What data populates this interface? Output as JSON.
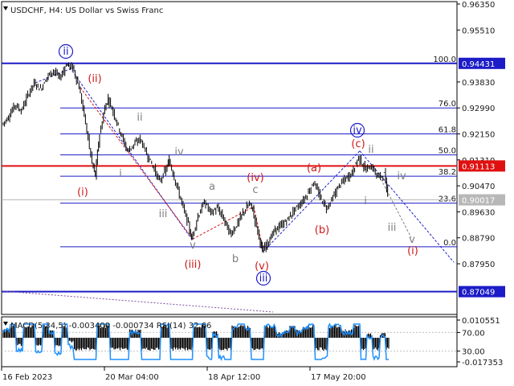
{
  "title": "USDCHF, H4:  US Dollar vs Swiss Franc",
  "colors": {
    "candle": "#000000",
    "fib_line": "#1c1cc8",
    "red_line": "#e01010",
    "grey_line": "#b8b8b8",
    "wave_red": "#d01818",
    "wave_grey": "#808080",
    "circle": "#1c1cc8",
    "macd_hist": "#000000",
    "rsi": "#1e90ff"
  },
  "price_axis": {
    "labels": [
      "0.96350",
      "0.95510",
      "0.93830",
      "0.92990",
      "0.92150",
      "0.91310",
      "0.90470",
      "0.89630",
      "0.88790",
      "0.87950"
    ],
    "values": [
      0.9635,
      0.9551,
      0.9383,
      0.9299,
      0.9215,
      0.9131,
      0.9047,
      0.8963,
      0.8879,
      0.8795
    ],
    "highlighted": [
      {
        "label": "0.94431",
        "value": 0.94431,
        "style": "blue"
      },
      {
        "label": "0.91113",
        "value": 0.91113,
        "style": "red"
      },
      {
        "label": "0.90017",
        "value": 0.90017,
        "style": "grey"
      },
      {
        "label": "0.87049",
        "value": 0.87049,
        "style": "blue"
      }
    ]
  },
  "fib_levels": [
    {
      "label": "100.0",
      "value": 0.9443
    },
    {
      "label": "76.0",
      "value": 0.9299
    },
    {
      "label": "61.8",
      "value": 0.9215
    },
    {
      "label": "50.0",
      "value": 0.9147
    },
    {
      "label": "38.2",
      "value": 0.9078
    },
    {
      "label": "23.6",
      "value": 0.8991
    },
    {
      "label": "0.0",
      "value": 0.885
    }
  ],
  "time_axis": [
    "16 Feb 2023",
    "20 Mar 04:00",
    "18 Apr 12:00",
    "17 May 20:00"
  ],
  "wave_labels": [
    {
      "text": "ii",
      "style": "circle"
    },
    {
      "text": "(ii)",
      "style": "red"
    },
    {
      "text": "ii",
      "style": "grey"
    },
    {
      "text": "i",
      "style": "grey"
    },
    {
      "text": "(i)",
      "style": "red"
    },
    {
      "text": "iv",
      "style": "grey"
    },
    {
      "text": "iii",
      "style": "grey"
    },
    {
      "text": "a",
      "style": "grey"
    },
    {
      "text": "(iv)",
      "style": "red"
    },
    {
      "text": "c",
      "style": "grey"
    },
    {
      "text": "v",
      "style": "grey"
    },
    {
      "text": "(iii)",
      "style": "red"
    },
    {
      "text": "b",
      "style": "grey"
    },
    {
      "text": "(v)",
      "style": "red"
    },
    {
      "text": "iii",
      "style": "circle"
    },
    {
      "text": "iv",
      "style": "circle"
    },
    {
      "text": "(c)",
      "style": "red"
    },
    {
      "text": "(a)",
      "style": "red"
    },
    {
      "text": "ii",
      "style": "grey"
    },
    {
      "text": "i",
      "style": "grey"
    },
    {
      "text": "(b)",
      "style": "red"
    },
    {
      "text": "iv",
      "style": "grey"
    },
    {
      "text": "iii",
      "style": "grey"
    },
    {
      "text": "v",
      "style": "grey"
    },
    {
      "text": "(i)",
      "style": "red"
    }
  ],
  "indicator": {
    "title": "MACD(5,34,5) -0.003400 -0.000734 RSI(14) 32.66",
    "axis_labels": [
      "0.010551",
      "70.00",
      "30.00",
      "-0.017353"
    ]
  },
  "chart_data": {
    "type": "candlestick",
    "symbol": "USDCHF",
    "timeframe": "H4",
    "title": "USDCHF, H4:  US Dollar vs Swiss Franc",
    "ylim": [
      0.8795,
      0.9635
    ],
    "close_path": [
      [
        0,
        0.9245
      ],
      [
        2,
        0.927
      ],
      [
        4,
        0.931
      ],
      [
        6,
        0.929
      ],
      [
        8,
        0.934
      ],
      [
        10,
        0.938
      ],
      [
        12,
        0.936
      ],
      [
        14,
        0.94
      ],
      [
        16,
        0.942
      ],
      [
        18,
        0.9395
      ],
      [
        20,
        0.944
      ],
      [
        22,
        0.943
      ],
      [
        24,
        0.9365
      ],
      [
        26,
        0.925
      ],
      [
        28,
        0.912
      ],
      [
        29,
        0.908
      ],
      [
        30,
        0.919
      ],
      [
        32,
        0.93
      ],
      [
        33,
        0.933
      ],
      [
        35,
        0.9275
      ],
      [
        37,
        0.9215
      ],
      [
        39,
        0.916
      ],
      [
        41,
        0.918
      ],
      [
        43,
        0.92
      ],
      [
        45,
        0.915
      ],
      [
        47,
        0.911
      ],
      [
        49,
        0.906
      ],
      [
        51,
        0.91
      ],
      [
        52,
        0.913
      ],
      [
        54,
        0.906
      ],
      [
        56,
        0.899
      ],
      [
        58,
        0.892
      ],
      [
        59,
        0.8875
      ],
      [
        61,
        0.895
      ],
      [
        63,
        0.8995
      ],
      [
        65,
        0.896
      ],
      [
        67,
        0.8975
      ],
      [
        69,
        0.894
      ],
      [
        71,
        0.889
      ],
      [
        73,
        0.892
      ],
      [
        75,
        0.896
      ],
      [
        77,
        0.899
      ],
      [
        78,
        0.897
      ],
      [
        80,
        0.888
      ],
      [
        81,
        0.8835
      ],
      [
        83,
        0.887
      ],
      [
        85,
        0.8905
      ],
      [
        87,
        0.892
      ],
      [
        89,
        0.894
      ],
      [
        91,
        0.897
      ],
      [
        93,
        0.899
      ],
      [
        95,
        0.902
      ],
      [
        97,
        0.906
      ],
      [
        99,
        0.901
      ],
      [
        101,
        0.8975
      ],
      [
        103,
        0.901
      ],
      [
        105,
        0.905
      ],
      [
        107,
        0.907
      ],
      [
        109,
        0.909
      ],
      [
        111,
        0.914
      ],
      [
        113,
        0.91
      ],
      [
        115,
        0.911
      ],
      [
        117,
        0.9075
      ],
      [
        119,
        0.9085
      ],
      [
        120,
        0.9015
      ]
    ],
    "horizontal_levels": [
      0.94431,
      0.91113,
      0.90017,
      0.87049
    ],
    "macd": [
      5,
      34,
      5
    ],
    "macd_values": [
      -0.0034,
      -0.000734
    ],
    "rsi_period": 14,
    "rsi_value": 32.66,
    "rsi_levels": [
      70,
      30
    ]
  }
}
